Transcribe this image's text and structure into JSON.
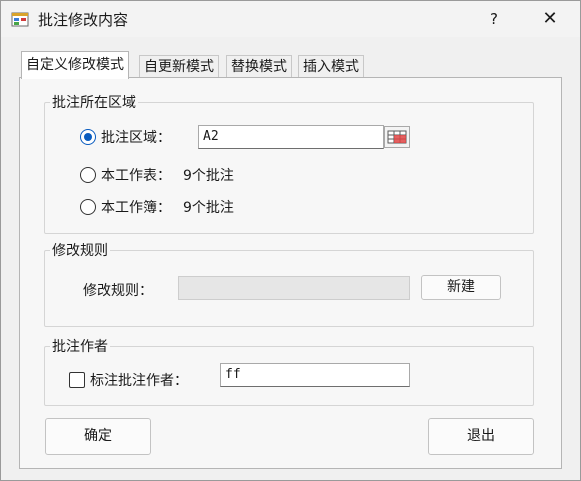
{
  "window": {
    "title": "批注修改内容",
    "help_label": "?",
    "close_label": "✕"
  },
  "tabs": [
    {
      "label": "自定义修改模式",
      "active": true
    },
    {
      "label": "自更新模式",
      "active": false
    },
    {
      "label": "替换模式",
      "active": false
    },
    {
      "label": "插入模式",
      "active": false
    }
  ],
  "location_group": {
    "legend": "批注所在区域",
    "options": [
      {
        "label": "批注区域：",
        "checked": true
      },
      {
        "label": "本工作表：",
        "value": "9个批注",
        "checked": false
      },
      {
        "label": "本工作簿：",
        "value": "9个批注",
        "checked": false
      }
    ],
    "range_value": "A2"
  },
  "rule_group": {
    "legend": "修改规则",
    "rule_label": "修改规则：",
    "rule_value": "",
    "new_button": "新建"
  },
  "author_group": {
    "legend": "批注作者",
    "checkbox_label": "标注批注作者：",
    "checked": false,
    "author_value": "ff"
  },
  "footer": {
    "ok_button": "确定",
    "exit_button": "退出"
  },
  "colors": {
    "accent": "#0a5cbf"
  }
}
